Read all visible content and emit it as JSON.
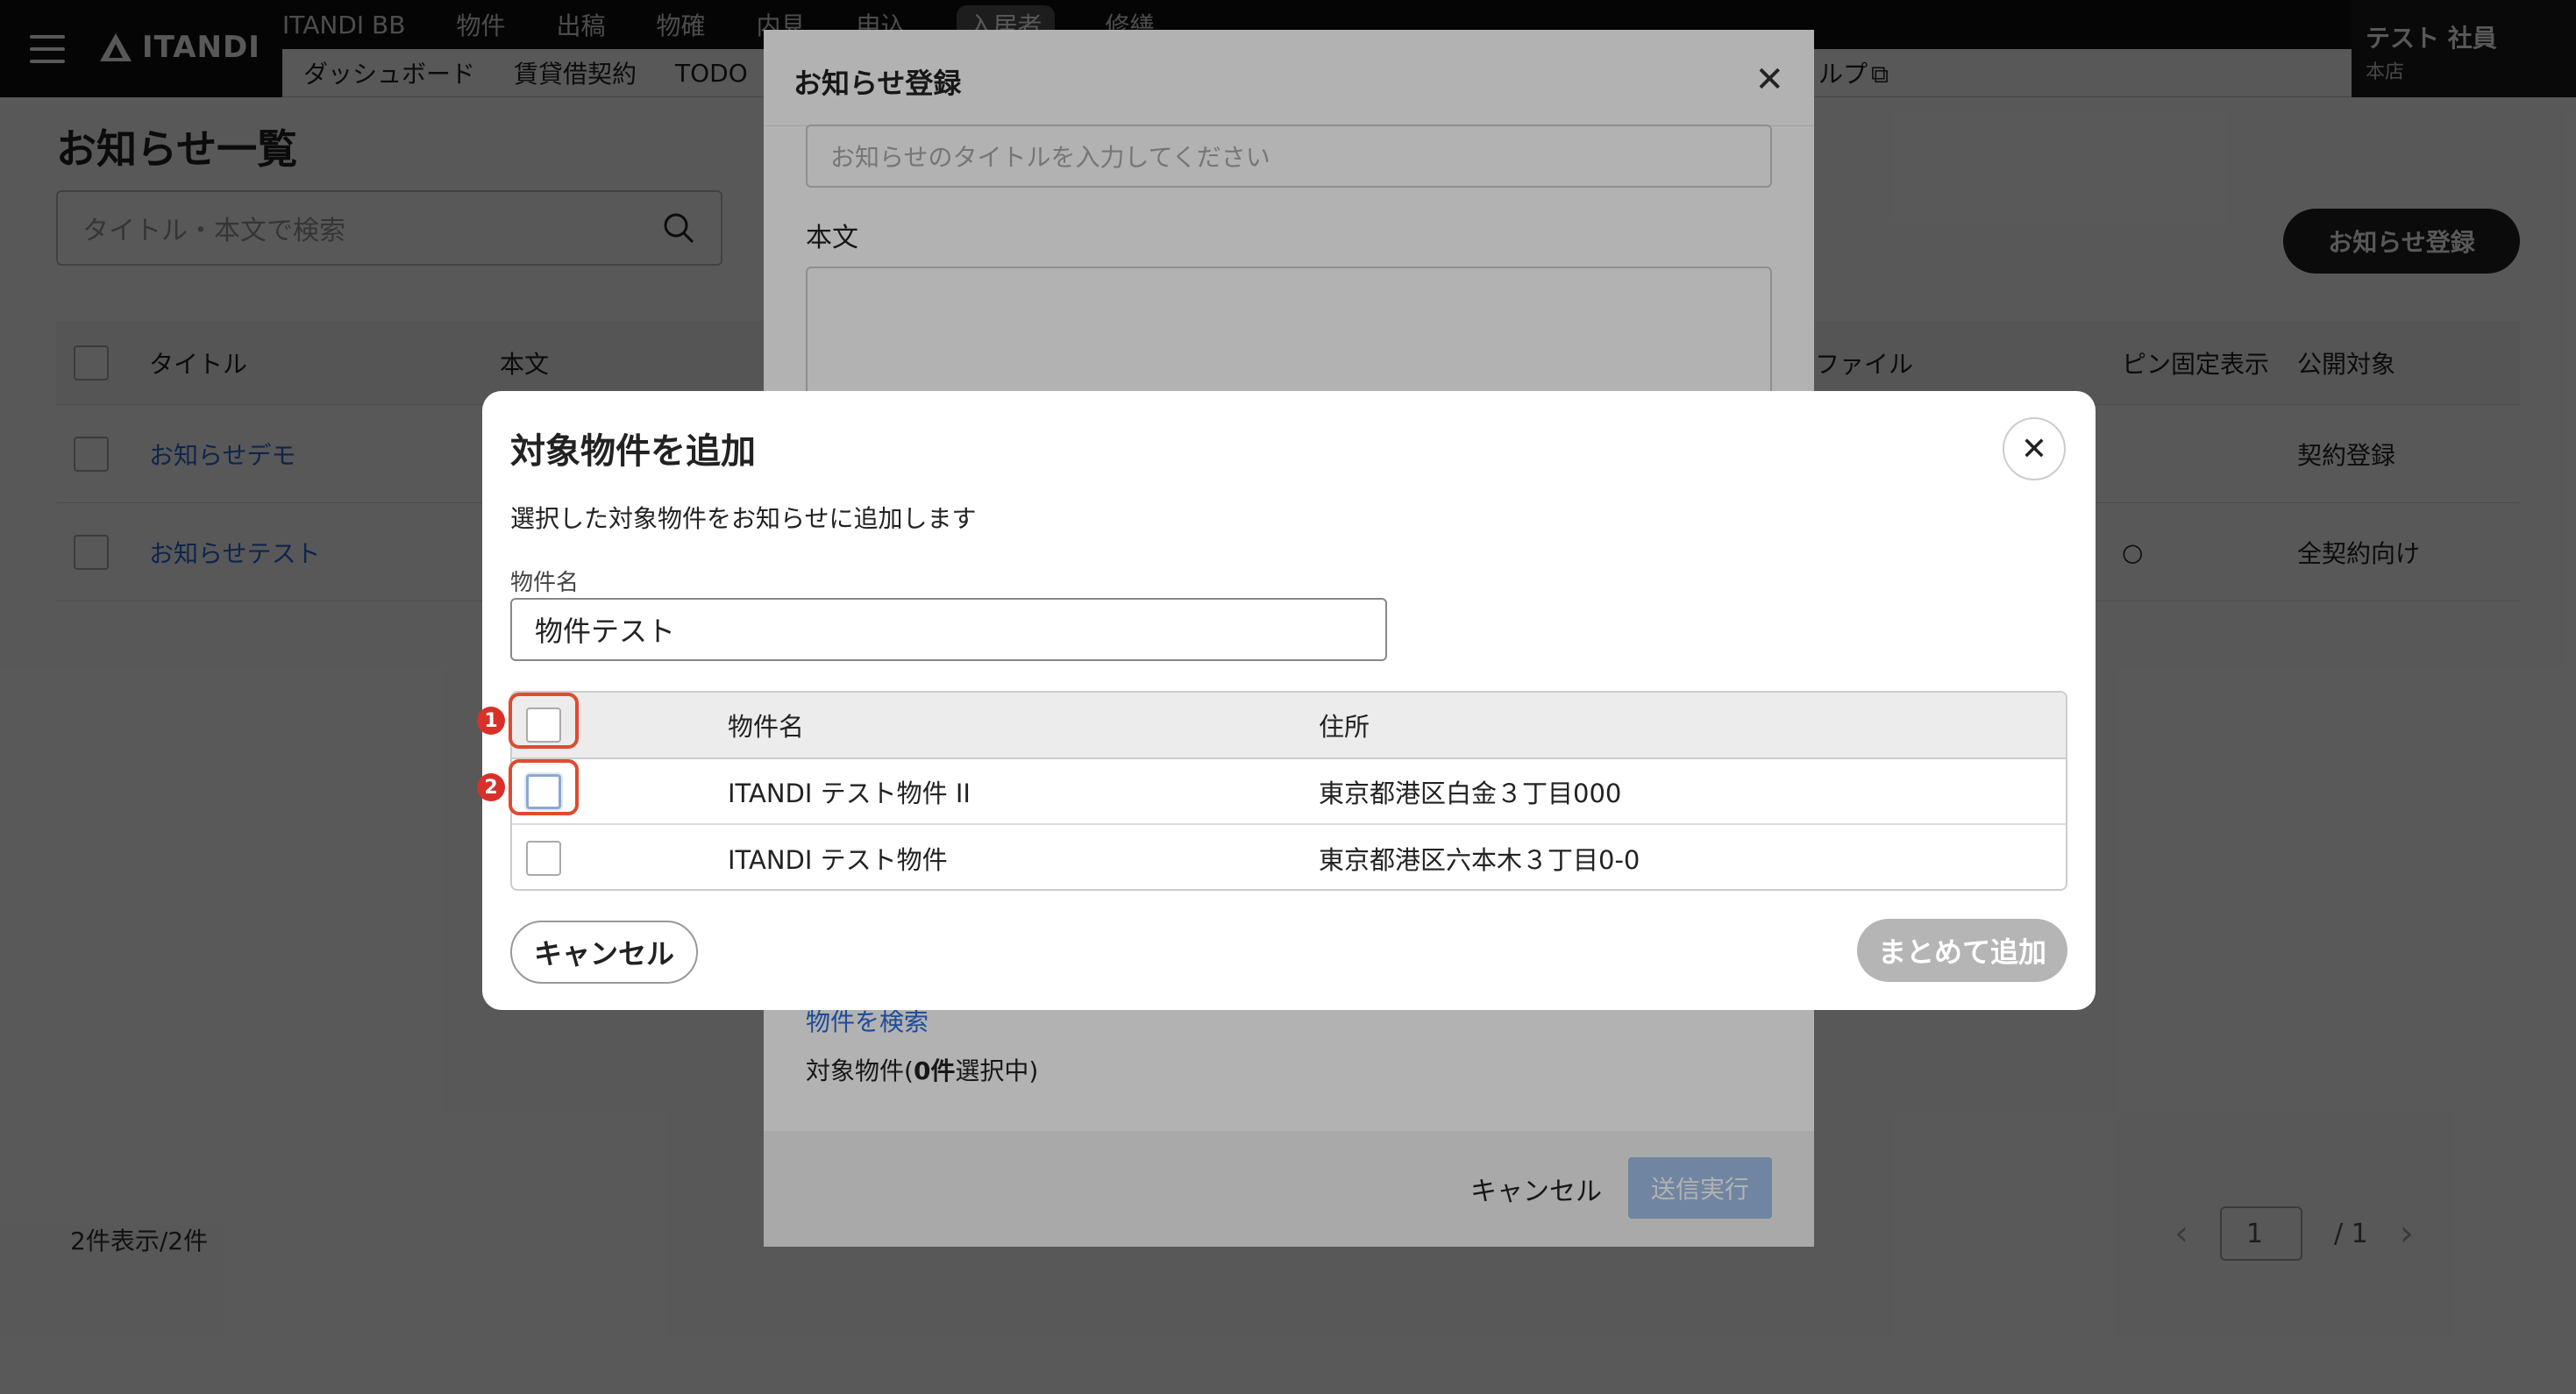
{
  "topnav": {
    "logo_text": "ITANDI",
    "row1": [
      "ITANDI BB",
      "物件",
      "出稿",
      "物確",
      "内見",
      "申込",
      "入居者",
      "修繕"
    ],
    "active_index": 6,
    "row2": [
      "ダッシュボード",
      "賃貸借契約",
      "TODO"
    ],
    "help_tail": "ルプ",
    "user_name": "テスト 社員",
    "user_branch": "本店"
  },
  "page": {
    "title": "お知らせ一覧",
    "search_placeholder": "タイトル・本文で検索",
    "register_button": "お知らせ登録",
    "columns": {
      "title": "タイトル",
      "body": "本文",
      "file": "ファイル",
      "pin": "ピン固定表示",
      "target": "公開対象"
    },
    "rows": [
      {
        "title": "お知らせデモ",
        "pin": "",
        "target": "契約登録"
      },
      {
        "title": "お知らせテスト",
        "pin": "○",
        "target": "全契約向け"
      }
    ],
    "count_text": "2件表示/2件",
    "pager": {
      "current": "1",
      "total": "/ 1"
    }
  },
  "register_modal": {
    "title": "お知らせ登録",
    "title_placeholder": "お知らせのタイトルを入力してください",
    "body_label": "本文",
    "search_link": "物件を検索",
    "selected_prefix": "対象物件(",
    "selected_count": "0件",
    "selected_suffix": "選択中)",
    "cancel": "キャンセル",
    "submit": "送信実行"
  },
  "add_modal": {
    "title": "対象物件を追加",
    "description": "選択した対象物件をお知らせに追加します",
    "field_label": "物件名",
    "field_value": "物件テスト",
    "columns": {
      "name": "物件名",
      "address": "住所"
    },
    "rows": [
      {
        "name": "ITANDI テスト物件 II",
        "address": "東京都港区白金３丁目000"
      },
      {
        "name": "ITANDI テスト物件",
        "address": "東京都港区六本木３丁目0-0"
      }
    ],
    "markers": [
      "1",
      "2"
    ],
    "cancel": "キャンセル",
    "add_all": "まとめて追加"
  },
  "colors": {
    "link": "#2a6dd9",
    "annotation": "#e04a2f",
    "disabled_button": "#b5b5b5"
  }
}
